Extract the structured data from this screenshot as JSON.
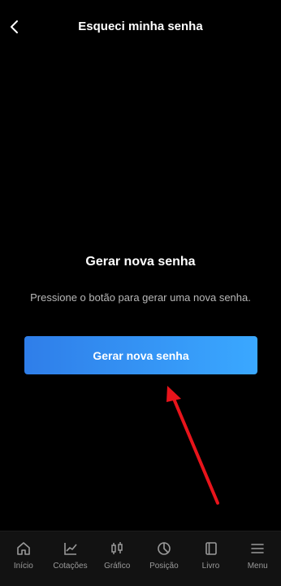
{
  "header": {
    "title": "Esqueci minha senha"
  },
  "main": {
    "heading": "Gerar nova senha",
    "description": "Pressione o botão para gerar uma nova senha.",
    "button_label": "Gerar nova senha"
  },
  "annotation": {
    "arrow_color": "#e8141b",
    "arrow_icon": "red-arrow-pointer"
  },
  "tabbar": {
    "items": [
      {
        "label": "Início",
        "icon": "home-icon"
      },
      {
        "label": "Cotações",
        "icon": "chart-line-icon"
      },
      {
        "label": "Gráfico",
        "icon": "candlestick-icon"
      },
      {
        "label": "Posição",
        "icon": "pie-chart-icon"
      },
      {
        "label": "Livro",
        "icon": "book-icon"
      },
      {
        "label": "Menu",
        "icon": "hamburger-icon"
      }
    ]
  },
  "colors": {
    "background": "#000000",
    "button_start": "#2f7ee9",
    "button_end": "#3aa8ff",
    "tabbar": "#121212"
  }
}
